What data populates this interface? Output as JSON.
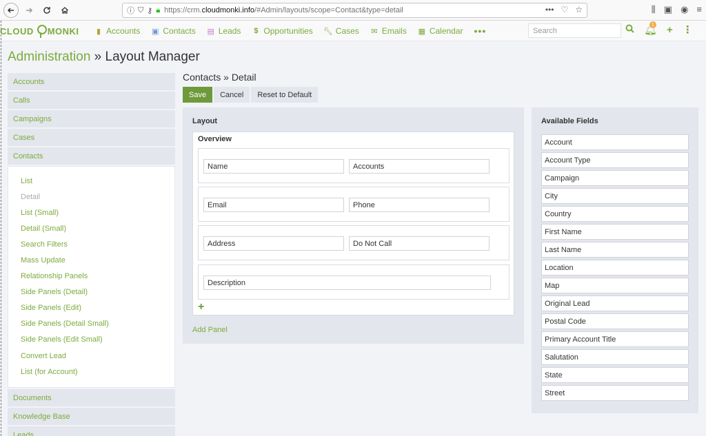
{
  "browser": {
    "url_prefix": "https://crm.",
    "url_domain": "cloudmonki.info",
    "url_path": "/#Admin/layouts/scope=Contact&type=detail"
  },
  "nav": {
    "logo_left": "CLOUD",
    "logo_right": "MONKI",
    "items": [
      {
        "label": "Accounts",
        "icon": "building-icon"
      },
      {
        "label": "Contacts",
        "icon": "person-icon"
      },
      {
        "label": "Leads",
        "icon": "id-card-icon"
      },
      {
        "label": "Opportunities",
        "icon": "dollar-icon"
      },
      {
        "label": "Cases",
        "icon": "wrench-icon"
      },
      {
        "label": "Emails",
        "icon": "envelope-icon"
      },
      {
        "label": "Calendar",
        "icon": "calendar-icon"
      }
    ],
    "more": "•••",
    "search_placeholder": "Search",
    "notification_count": "1"
  },
  "page": {
    "crumb": "Administration",
    "separator": " » ",
    "title": "Layout Manager"
  },
  "sidebar": {
    "groups_top": [
      "Accounts",
      "Calls",
      "Campaigns",
      "Cases",
      "Contacts"
    ],
    "contact_items": [
      {
        "label": "List",
        "active": false
      },
      {
        "label": "Detail",
        "active": true
      },
      {
        "label": "List (Small)",
        "active": false
      },
      {
        "label": "Detail (Small)",
        "active": false
      },
      {
        "label": "Search Filters",
        "active": false
      },
      {
        "label": "Mass Update",
        "active": false
      },
      {
        "label": "Relationship Panels",
        "active": false
      },
      {
        "label": "Side Panels (Detail)",
        "active": false
      },
      {
        "label": "Side Panels (Edit)",
        "active": false
      },
      {
        "label": "Side Panels (Detail Small)",
        "active": false
      },
      {
        "label": "Side Panels (Edit Small)",
        "active": false
      },
      {
        "label": "Convert Lead",
        "active": false
      },
      {
        "label": "List (for Account)",
        "active": false
      }
    ],
    "groups_bottom": [
      "Documents",
      "Knowledge Base",
      "Leads"
    ]
  },
  "main": {
    "title": "Contacts » Detail",
    "buttons": {
      "save": "Save",
      "cancel": "Cancel",
      "reset": "Reset to Default"
    },
    "layout_heading": "Layout",
    "panel_title": "Overview",
    "rows": [
      [
        "Name",
        "Accounts"
      ],
      [
        "Email",
        "Phone"
      ],
      [
        "Address",
        "Do Not Call"
      ],
      [
        "Description"
      ]
    ],
    "add_panel": "Add Panel"
  },
  "available": {
    "heading": "Available Fields",
    "fields": [
      "Account",
      "Account Type",
      "Campaign",
      "City",
      "Country",
      "First Name",
      "Last Name",
      "Location",
      "Map",
      "Original Lead",
      "Postal Code",
      "Primary Account Title",
      "Salutation",
      "State",
      "Street"
    ]
  },
  "colors": {
    "accent": "#7bab3c",
    "primary_button": "#6f9a3b",
    "panel_bg": "#e3e6ec"
  }
}
